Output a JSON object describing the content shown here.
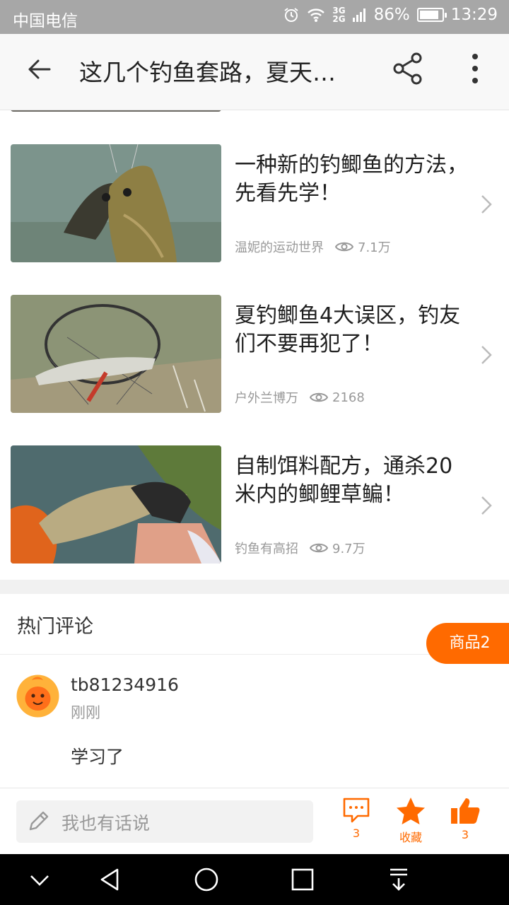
{
  "status_bar": {
    "carrier": "中国电信",
    "network_top": "3G",
    "network_bottom": "2G",
    "battery": "86%",
    "battery_level": 0.86,
    "time": "13:29"
  },
  "app_bar": {
    "title": "这几个钓鱼套路，夏天…"
  },
  "articles": [
    {
      "title": "一种新的钓鲫鱼的方法，先看先学！",
      "source": "温妮的运动世界",
      "views": "7.1万"
    },
    {
      "title": "夏钓鲫鱼4大误区，钓友们不要再犯了！",
      "source": "户外兰博万",
      "views": "2168"
    },
    {
      "title": "自制饵料配方，通杀20米内的鲫鲤草鳊！",
      "source": "钓鱼有高招",
      "views": "9.7万"
    }
  ],
  "comments_section": {
    "header": "热门评论",
    "goods_tab": "商品2",
    "comments": [
      {
        "user": "tb81234916",
        "time": "刚刚",
        "text": "学习了"
      }
    ]
  },
  "bottom_bar": {
    "placeholder": "我也有话说",
    "comment_count": "3",
    "favorite_label": "收藏",
    "like_count": "3"
  },
  "colors": {
    "accent": "#ff6a00",
    "status_bar": "#a7a7a7",
    "app_bar": "#f8f8f8"
  }
}
